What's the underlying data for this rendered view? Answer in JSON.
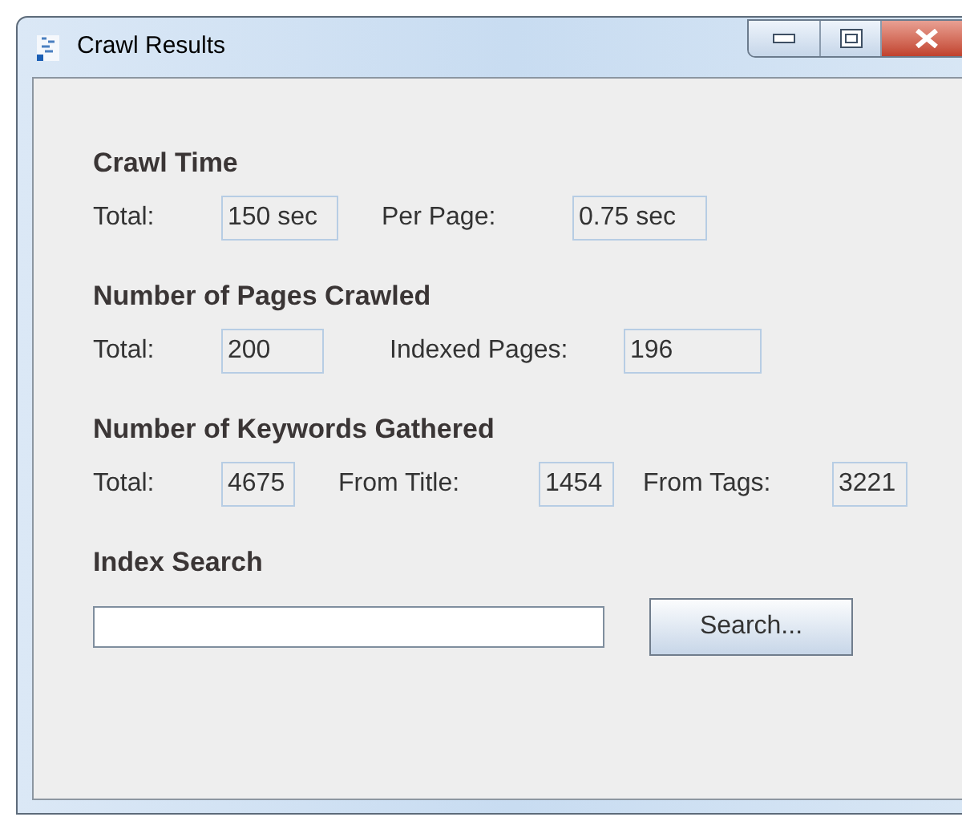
{
  "window": {
    "title": "Crawl Results"
  },
  "sections": [
    {
      "heading": "Crawl Time",
      "fields": [
        {
          "label": "Total:",
          "value": "150 sec"
        },
        {
          "label": "Per Page:",
          "value": "0.75 sec"
        }
      ]
    },
    {
      "heading": "Number of Pages Crawled",
      "fields": [
        {
          "label": "Total:",
          "value": "200"
        },
        {
          "label": "Indexed Pages:",
          "value": "196"
        }
      ]
    },
    {
      "heading": "Number of Keywords Gathered",
      "fields": [
        {
          "label": "Total:",
          "value": "4675"
        },
        {
          "label": "From Title:",
          "value": "1454"
        },
        {
          "label": "From Tags:",
          "value": "3221"
        }
      ]
    }
  ],
  "search": {
    "heading": "Index Search",
    "button": "Search..."
  }
}
